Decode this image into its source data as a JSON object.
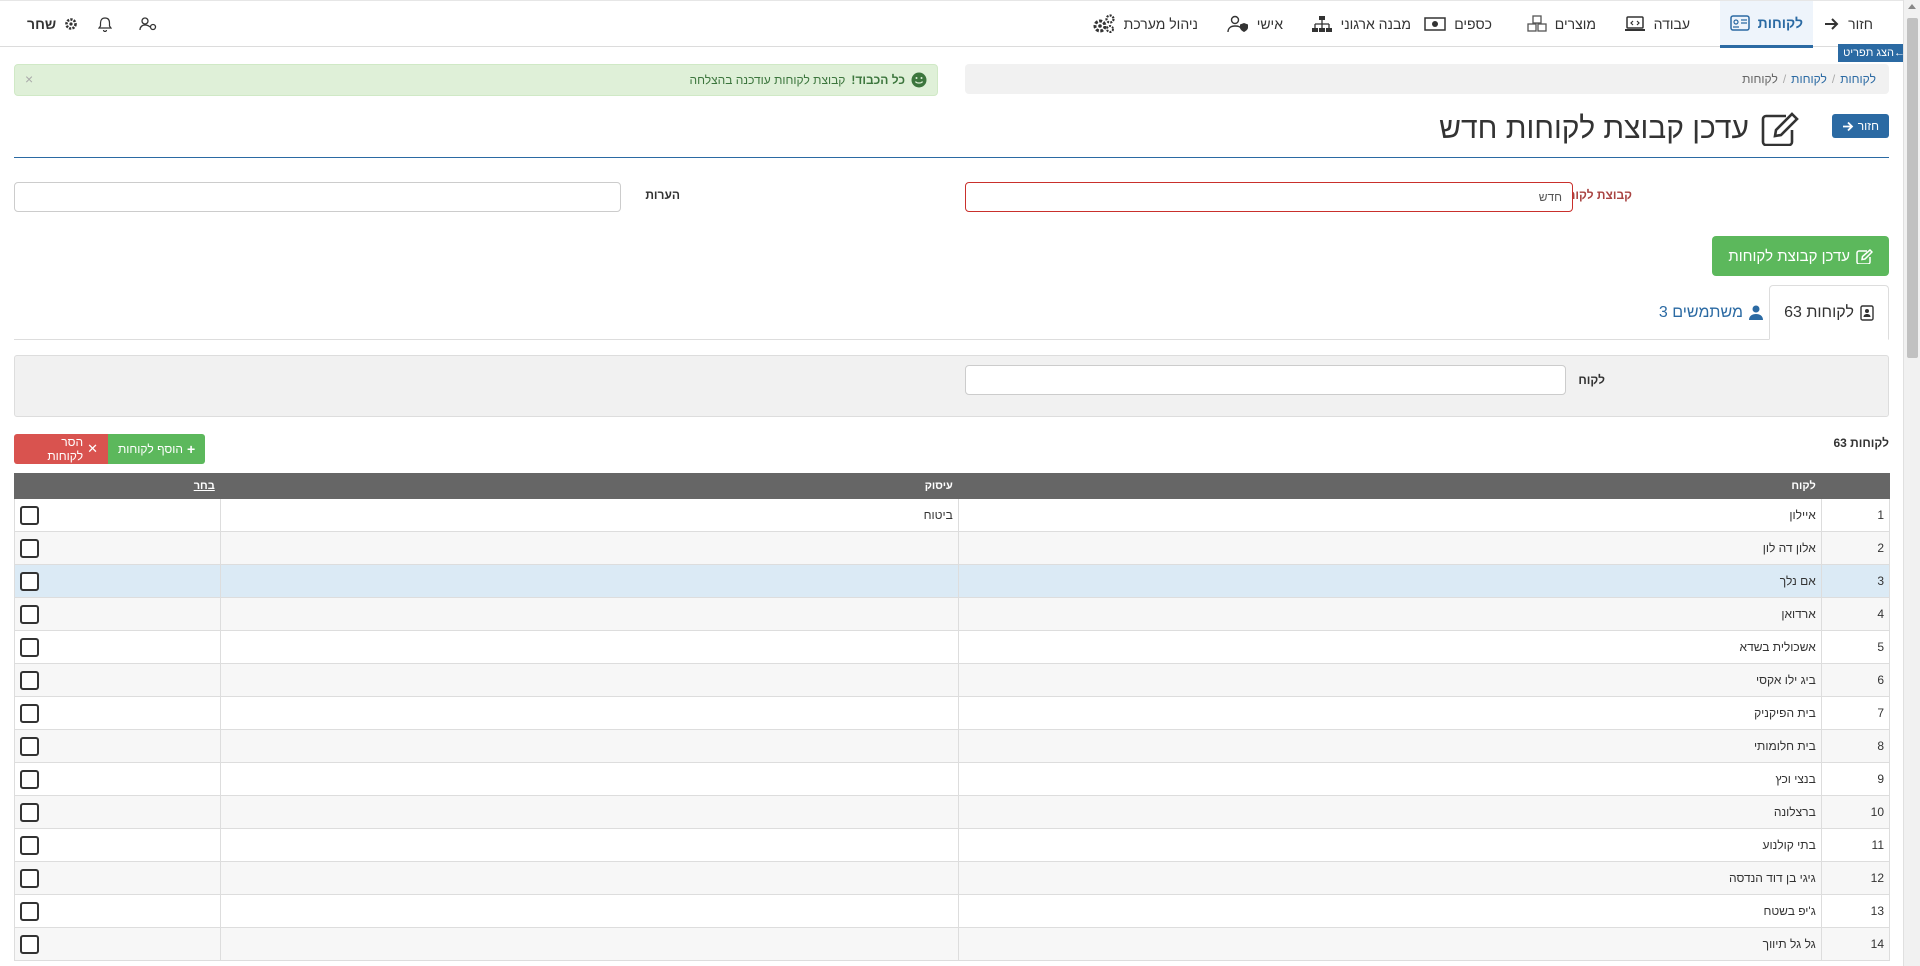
{
  "nav": {
    "back": "חזור",
    "customers": "לקוחות",
    "work": "עבודה",
    "products": "מוצרים",
    "money": "כספים",
    "org_structure": "מבנה ארגוני",
    "personal": "אישי",
    "system_admin": "ניהול מערכת",
    "user": "שחר",
    "show_items": "הצג תפריט←"
  },
  "breadcrumb": [
    "לקוחות",
    "לקוחות",
    "לקוחות"
  ],
  "alert": {
    "strong": "כל הכבוד!",
    "text": "קבוצת לקוחות עודכנה בהצלחה"
  },
  "title": "עדכן קבוצת לקוחות חדש",
  "back_button": "חזור",
  "form": {
    "group_label": "קבוצת לקוחות",
    "group_value": "חדש",
    "notes_label": "הערות",
    "notes_value": ""
  },
  "update_button": "עדכן קבוצת לקוחות",
  "tabs": [
    {
      "label": "לקוחות 63"
    },
    {
      "label": "משתמשים 3"
    }
  ],
  "filter": {
    "customer_label": "לקוח",
    "customer_value": ""
  },
  "count_label": "לקוחות 63",
  "add_button": "הוסף לקוחות",
  "remove_button": "הסר לקוחות",
  "table": {
    "headers": [
      "",
      "לקוח",
      "עיסוק",
      "בחר"
    ],
    "rows": [
      {
        "n": "1",
        "name": "איילון",
        "occupation": "ביטוח"
      },
      {
        "n": "2",
        "name": "אלון דה לון",
        "occupation": ""
      },
      {
        "n": "3",
        "name": "אם נלך",
        "occupation": ""
      },
      {
        "n": "4",
        "name": "ארדואן",
        "occupation": ""
      },
      {
        "n": "5",
        "name": "אשכולית בשדא",
        "occupation": ""
      },
      {
        "n": "6",
        "name": "ביג ילו אקסי",
        "occupation": ""
      },
      {
        "n": "7",
        "name": "בית הפיקניק",
        "occupation": ""
      },
      {
        "n": "8",
        "name": "בית חלומותי",
        "occupation": ""
      },
      {
        "n": "9",
        "name": "בנצי וכץ",
        "occupation": ""
      },
      {
        "n": "10",
        "name": "ברצלונה",
        "occupation": ""
      },
      {
        "n": "11",
        "name": "בתי קולנוע",
        "occupation": ""
      },
      {
        "n": "12",
        "name": "גיגי בן דוד הנדסה",
        "occupation": ""
      },
      {
        "n": "13",
        "name": "ג'יפ בשטח",
        "occupation": ""
      },
      {
        "n": "14",
        "name": "גל גל תיווך",
        "occupation": ""
      }
    ]
  }
}
